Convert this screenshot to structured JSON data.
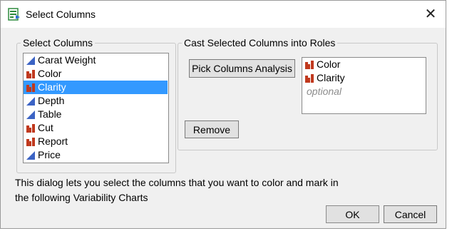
{
  "window": {
    "title": "Select Columns",
    "close_glyph": "✕"
  },
  "select_columns": {
    "label": "Select Columns",
    "items": [
      {
        "label": "Carat Weight",
        "icon": "continuous-icon",
        "selected": false
      },
      {
        "label": "Color",
        "icon": "nominal-icon",
        "selected": false
      },
      {
        "label": "Clarity",
        "icon": "nominal-icon",
        "selected": true
      },
      {
        "label": "Depth",
        "icon": "continuous-icon",
        "selected": false
      },
      {
        "label": "Table",
        "icon": "continuous-icon",
        "selected": false
      },
      {
        "label": "Cut",
        "icon": "nominal-icon",
        "selected": false
      },
      {
        "label": "Report",
        "icon": "nominal-icon",
        "selected": false
      },
      {
        "label": "Price",
        "icon": "continuous-icon",
        "selected": false
      }
    ]
  },
  "cast_roles": {
    "label": "Cast Selected Columns into Roles",
    "pick_button": "Pick Columns Analysis",
    "assigned": [
      {
        "label": "Color",
        "icon": "nominal-icon"
      },
      {
        "label": "Clarity",
        "icon": "nominal-icon"
      }
    ],
    "optional_text": "optional",
    "remove_button": "Remove"
  },
  "info_text": "This dialog lets you select the columns that you want to color and mark in the following Variability Charts",
  "footer": {
    "ok_label": "OK",
    "cancel_label": "Cancel"
  },
  "colors": {
    "selection": "#3399ff",
    "continuous": "#3b63c4",
    "nominal": "#c0391e",
    "dialog_bg": "#f0f0f0"
  }
}
